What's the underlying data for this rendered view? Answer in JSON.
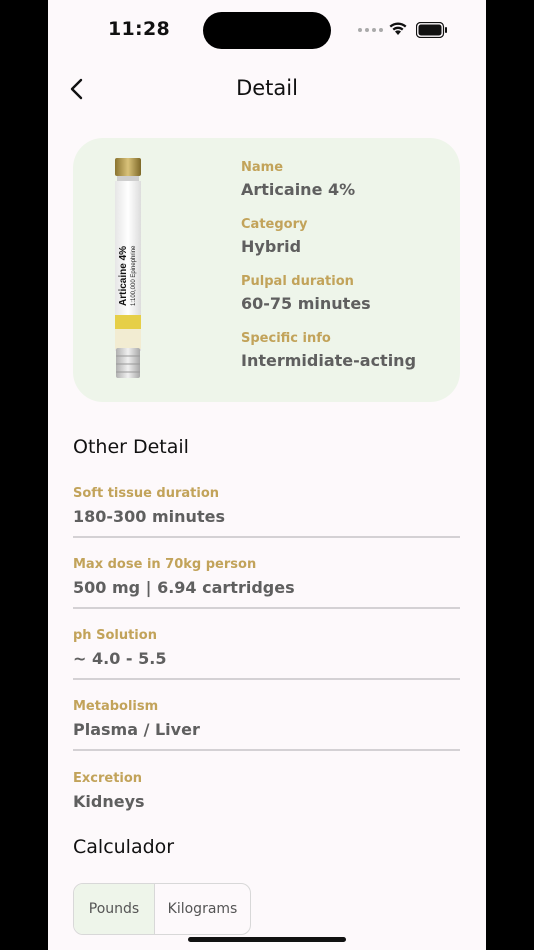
{
  "status_bar": {
    "time": "11:28"
  },
  "nav": {
    "title": "Detail"
  },
  "drug_card": {
    "cartridge_label": "Articaine 4%",
    "cartridge_sublabel": "1:100,000 Epinephrine",
    "fields": [
      {
        "label": "Name",
        "value": "Articaine 4%"
      },
      {
        "label": "Category",
        "value": "Hybrid"
      },
      {
        "label": "Pulpal duration",
        "value": "60-75 minutes"
      },
      {
        "label": "Specific info",
        "value": "Intermidiate-acting"
      }
    ]
  },
  "other_detail": {
    "heading": "Other Detail",
    "fields": [
      {
        "label": "Soft tissue duration",
        "value": "180-300 minutes"
      },
      {
        "label": "Max dose in 70kg person",
        "value": "500 mg | 6.94 cartridges"
      },
      {
        "label": "ph Solution",
        "value": "~ 4.0 - 5.5"
      },
      {
        "label": "Metabolism",
        "value": "Plasma / Liver"
      },
      {
        "label": "Excretion",
        "value": "Kidneys"
      }
    ]
  },
  "calculator": {
    "heading": "Calculador",
    "options": [
      "Pounds",
      "Kilograms"
    ],
    "selected": "Pounds"
  },
  "colors": {
    "accent_label": "#c2a35a",
    "card_background": "#eef5ea",
    "page_background": "#fdf9fb"
  }
}
